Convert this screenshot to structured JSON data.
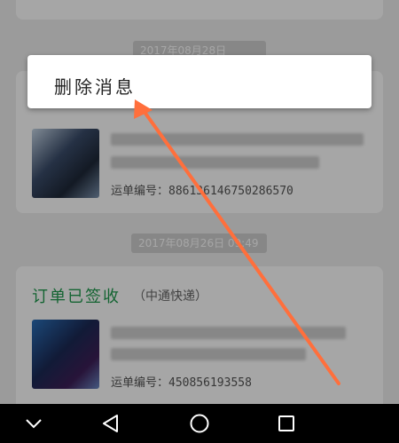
{
  "timeline": {
    "date1": "2017年08月28日 11:45",
    "date2": "2017年08月26日 09:49"
  },
  "cards": {
    "middle": {
      "waybill": "运单编号：886136146750286570"
    },
    "bottom": {
      "status": "订单已签收",
      "courier": "（中通快递）",
      "waybill": "运单编号：450856193558"
    }
  },
  "popup": {
    "delete_label": "删除消息"
  },
  "colors": {
    "status_green": "#1f9a4e",
    "arrow": "#ff6f3c",
    "overlay": "rgba(0,0,0,0.35)",
    "navbar": "#000000"
  },
  "icons": {
    "nav_down": "chevron-down-icon",
    "nav_back": "triangle-back-icon",
    "nav_home": "circle-home-icon",
    "nav_recent": "square-recent-icon"
  }
}
